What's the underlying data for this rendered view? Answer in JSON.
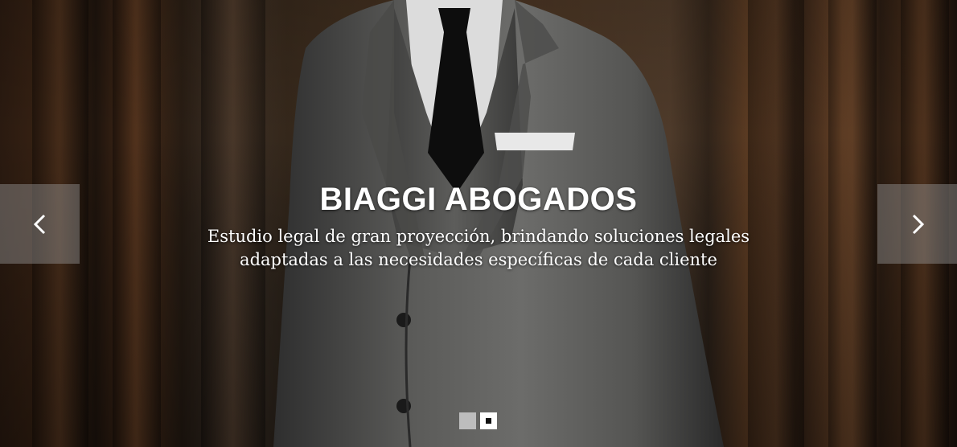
{
  "hero": {
    "title": "BIAGGI ABOGADOS",
    "subtitle_line1": "Estudio legal de gran proyección,  brindando soluciones legales",
    "subtitle_line2": "adaptadas a las necesidades específicas de cada cliente"
  },
  "controls": {
    "prev_icon": "chevron-left-icon",
    "next_icon": "chevron-right-icon",
    "slide_count": 2,
    "active_slide": 2
  },
  "colors": {
    "text": "#ffffff",
    "arrow_bg": "rgba(150,150,150,0.45)",
    "dot_inactive": "#bdbdbd",
    "dot_active": "#ffffff"
  }
}
